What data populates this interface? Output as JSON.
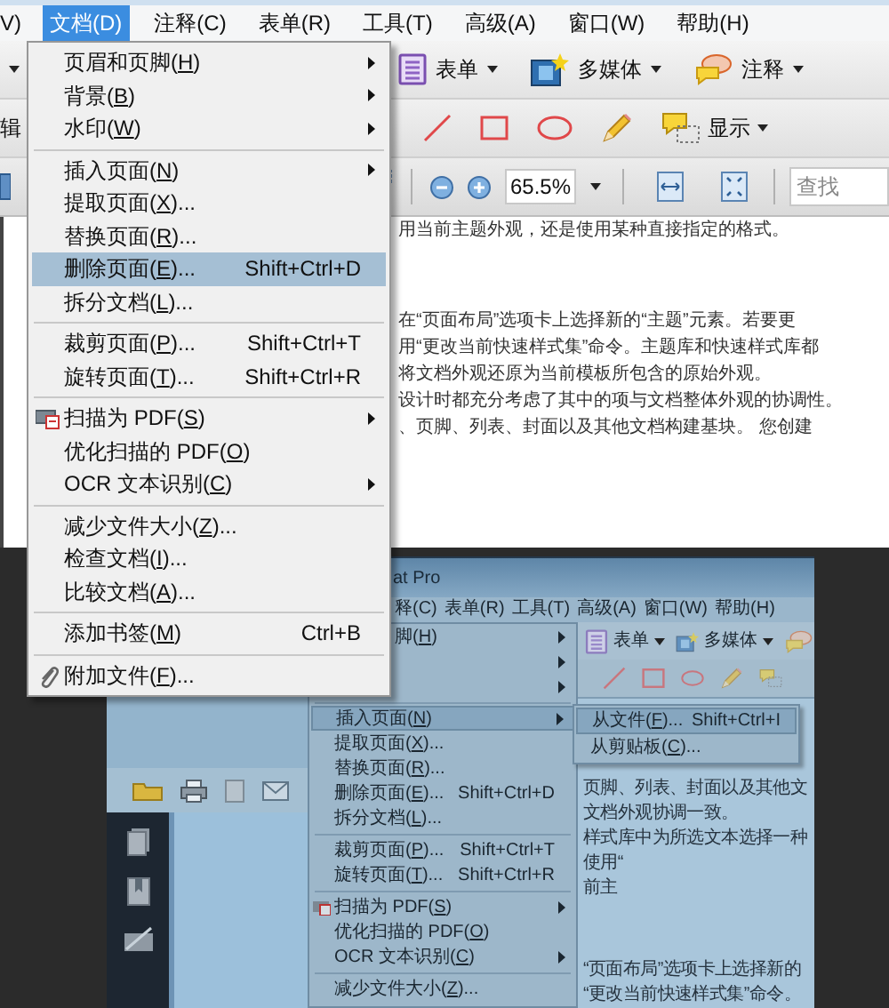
{
  "menubar": [
    {
      "label": "V)",
      "selected": false
    },
    {
      "label": "文档(D)",
      "selected": true
    },
    {
      "label": "注释(C)",
      "selected": false
    },
    {
      "label": "表单(R)",
      "selected": false
    },
    {
      "label": "工具(T)",
      "selected": false
    },
    {
      "label": "高级(A)",
      "selected": false
    },
    {
      "label": "窗口(W)",
      "selected": false
    },
    {
      "label": "帮助(H)",
      "selected": false
    }
  ],
  "toolbar": {
    "cut_label": "辑",
    "buttons": [
      "表单",
      "多媒体",
      "注释"
    ],
    "show_button": "显示",
    "zoom": "65.5%",
    "search_placeholder": "查找"
  },
  "document_lines": [
    "用当前主题外观，还是使用某种直接指定的格式。",
    "在“页面布局”选项卡上选择新的“主题”元素。若要更",
    "用“更改当前快速样式集”命令。主题库和快速样式库都",
    "将文档外观还原为当前模板所包含的原始外观。",
    "设计时都充分考虑了其中的项与文档整体外观的协调性。",
    "、页脚、列表、封面以及其他文档构建基块。 您创建"
  ],
  "menu": {
    "items": [
      {
        "kind": "item",
        "label": "页眉和页脚(H)",
        "submenu": true,
        "selected": false
      },
      {
        "kind": "item",
        "label": "背景(B)",
        "submenu": true,
        "selected": false
      },
      {
        "kind": "item",
        "label": "水印(W)",
        "submenu": true,
        "selected": false
      },
      {
        "kind": "separator"
      },
      {
        "kind": "item",
        "label": "插入页面(N)",
        "submenu": true,
        "selected": false
      },
      {
        "kind": "item",
        "label": "提取页面(X)...",
        "submenu": false,
        "selected": false
      },
      {
        "kind": "item",
        "label": "替换页面(R)...",
        "submenu": false,
        "selected": false
      },
      {
        "kind": "item",
        "label": "删除页面(E)...",
        "shortcut": "Shift+Ctrl+D",
        "submenu": false,
        "selected": true
      },
      {
        "kind": "item",
        "label": "拆分文档(L)...",
        "submenu": false,
        "selected": false
      },
      {
        "kind": "separator"
      },
      {
        "kind": "item",
        "label": "裁剪页面(P)...",
        "shortcut": "Shift+Ctrl+T",
        "submenu": false,
        "selected": false
      },
      {
        "kind": "item",
        "label": "旋转页面(T)...",
        "shortcut": "Shift+Ctrl+R",
        "submenu": false,
        "selected": false
      },
      {
        "kind": "separator"
      },
      {
        "kind": "item",
        "label": "扫描为 PDF(S)",
        "submenu": true,
        "selected": false
      },
      {
        "kind": "item",
        "label": "优化扫描的 PDF(O)",
        "submenu": false,
        "selected": false
      },
      {
        "kind": "item",
        "label": "OCR 文本识别(C)",
        "submenu": true,
        "selected": false
      },
      {
        "kind": "separator"
      },
      {
        "kind": "item",
        "label": "减少文件大小(Z)...",
        "submenu": false,
        "selected": false
      },
      {
        "kind": "item",
        "label": "检查文档(I)...",
        "submenu": false,
        "selected": false
      },
      {
        "kind": "item",
        "label": "比较文档(A)...",
        "submenu": false,
        "selected": false
      },
      {
        "kind": "separator"
      },
      {
        "kind": "item",
        "label": "添加书签(M)",
        "shortcut": "Ctrl+B",
        "submenu": false,
        "selected": false
      },
      {
        "kind": "separator"
      },
      {
        "kind": "item",
        "label": "附加文件(F)...",
        "submenu": false,
        "selected": false
      }
    ]
  },
  "inner_screenshot": {
    "title": "at Pro",
    "menubar": [
      "释(C)",
      "表单(R)",
      "工具(T)",
      "高级(A)",
      "窗口(W)",
      "帮助(H)"
    ],
    "toolbar_buttons": [
      "表单",
      "多媒体"
    ],
    "menu": {
      "items": [
        {
          "kind": "item",
          "label": "脚(H)",
          "submenu": true,
          "selected": false
        },
        {
          "kind": "item",
          "submenu": true,
          "selected": false
        },
        {
          "kind": "item",
          "submenu": true,
          "selected": false
        },
        {
          "kind": "separator"
        },
        {
          "kind": "item",
          "label": "插入页面(N)",
          "submenu": true,
          "selected": true
        },
        {
          "kind": "item",
          "label": "提取页面(X)...",
          "submenu": false,
          "selected": false
        },
        {
          "kind": "item",
          "label": "替换页面(R)...",
          "submenu": false,
          "selected": false
        },
        {
          "kind": "item",
          "label": "删除页面(E)...",
          "shortcut": "Shift+Ctrl+D",
          "submenu": false,
          "selected": false
        },
        {
          "kind": "item",
          "label": "拆分文档(L)...",
          "submenu": false,
          "selected": false
        },
        {
          "kind": "separator"
        },
        {
          "kind": "item",
          "label": "裁剪页面(P)...",
          "shortcut": "Shift+Ctrl+T",
          "submenu": false,
          "selected": false
        },
        {
          "kind": "item",
          "label": "旋转页面(T)...",
          "shortcut": "Shift+Ctrl+R",
          "submenu": false,
          "selected": false
        },
        {
          "kind": "separator"
        },
        {
          "kind": "item",
          "label": "扫描为 PDF(S)",
          "submenu": true,
          "selected": false
        },
        {
          "kind": "item",
          "label": "优化扫描的 PDF(O)",
          "submenu": false,
          "selected": false
        },
        {
          "kind": "item",
          "label": "OCR 文本识别(C)",
          "submenu": true,
          "selected": false
        },
        {
          "kind": "separator"
        },
        {
          "kind": "item",
          "label": "减少文件大小(Z)...",
          "submenu": false,
          "selected": false
        }
      ]
    },
    "submenu": {
      "items": [
        {
          "label": "从文件(F)...",
          "shortcut": "Shift+Ctrl+I",
          "selected": true
        },
        {
          "label": "从剪贴板(C)...",
          "selected": false
        }
      ]
    },
    "document_lines": [
      "页脚、列表、封面以及其他文",
      "文档外观协调一致。",
      "样式库中为所选文本选择一种",
      "使用“",
      "前主",
      "“页面布局”选项卡上选择新的",
      "“更改当前快速样式集”命令。"
    ]
  }
}
